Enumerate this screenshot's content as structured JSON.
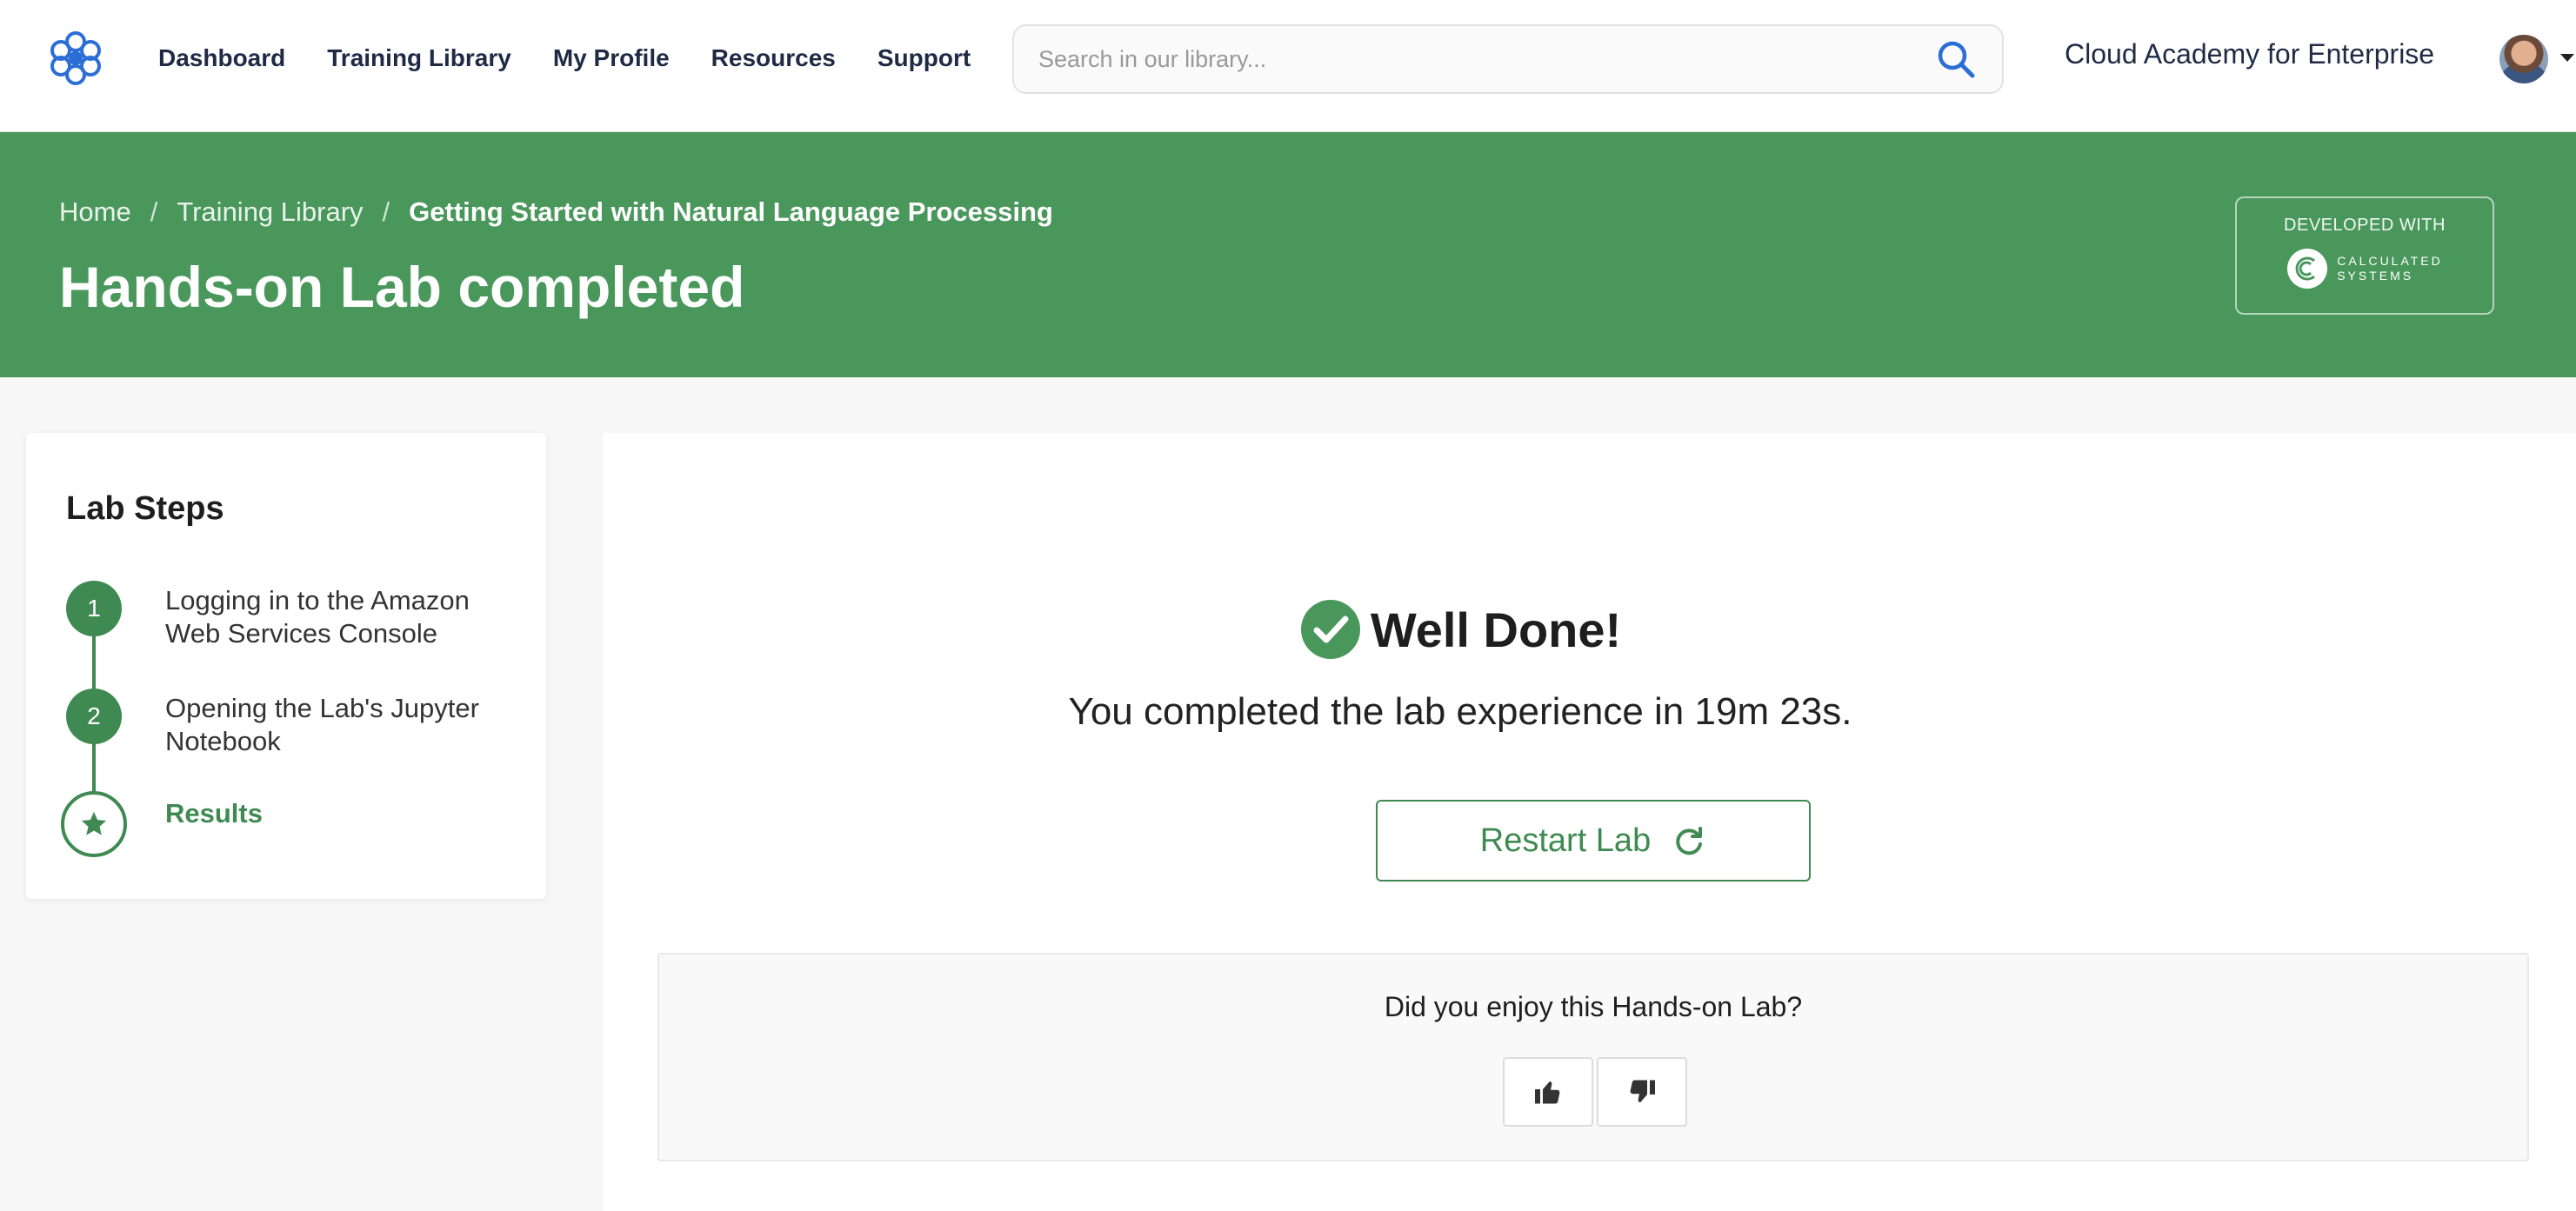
{
  "nav": {
    "logo": "cloud-academy-logo",
    "links": [
      "Dashboard",
      "Training Library",
      "My Profile",
      "Resources",
      "Support"
    ],
    "search_placeholder": "Search in our library...",
    "org_name": "Cloud Academy for Enterprise"
  },
  "hero": {
    "breadcrumb": [
      "Home",
      "Training Library",
      "Getting Started with Natural Language Processing"
    ],
    "breadcrumb_separator": "/",
    "title": "Hands-on Lab completed",
    "developed_with_label": "DEVELOPED WITH",
    "partner_line1": "CALCULATED",
    "partner_line2": "SYSTEMS"
  },
  "sidebar": {
    "title": "Lab Steps",
    "steps": [
      {
        "number": "1",
        "label": "Logging in to the Amazon Web Services Console"
      },
      {
        "number": "2",
        "label": "Opening the Lab's Jupyter Notebook"
      },
      {
        "number": "",
        "label": "Results",
        "icon": "star-icon"
      }
    ]
  },
  "result": {
    "heading": "Well Done!",
    "summary": "You completed the lab experience in 19m 23s.",
    "restart_label": "Restart Lab",
    "feedback_question": "Did you enjoy this Hands-on Lab?"
  },
  "colors": {
    "brand_green": "#4a975c",
    "accent_green": "#3f8a52",
    "nav_text": "#1f2a44",
    "logo_blue": "#2b6fd6"
  }
}
